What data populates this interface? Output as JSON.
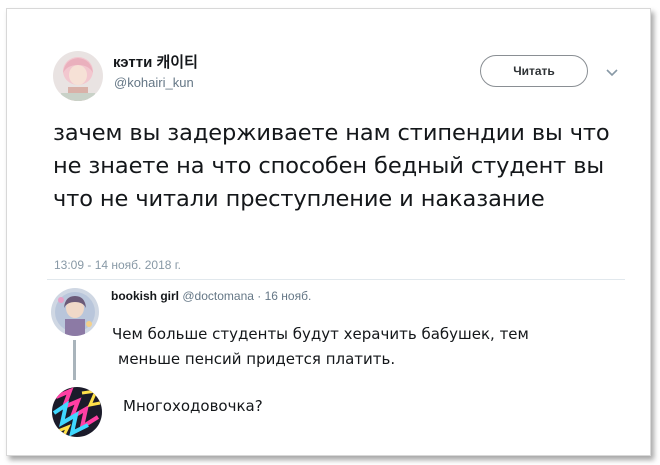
{
  "tweet": {
    "display_name": "кэтти 캐이티",
    "handle": "@kohairi_kun",
    "follow_label": "Читать",
    "text": "зачем вы задерживаете нам стипендии вы что не знаете на что способен бедный студент вы что не читали преступление и наказание",
    "timestamp": "13:09 - 14 нояб. 2018 г."
  },
  "reply": {
    "name": "bookish girl",
    "handle": "@doctomana",
    "separator": "·",
    "date": "16 нояб.",
    "line1": "Чем больше студенты будут херачить бабушек, тем",
    "line2": "меньше пенсий придется платить."
  },
  "self_reply": {
    "text": "Многоходовочка?"
  },
  "colors": {
    "text": "#14171a",
    "muted": "#657786",
    "timestamp": "#8899a6",
    "thread_line": "#a9b4bb"
  }
}
